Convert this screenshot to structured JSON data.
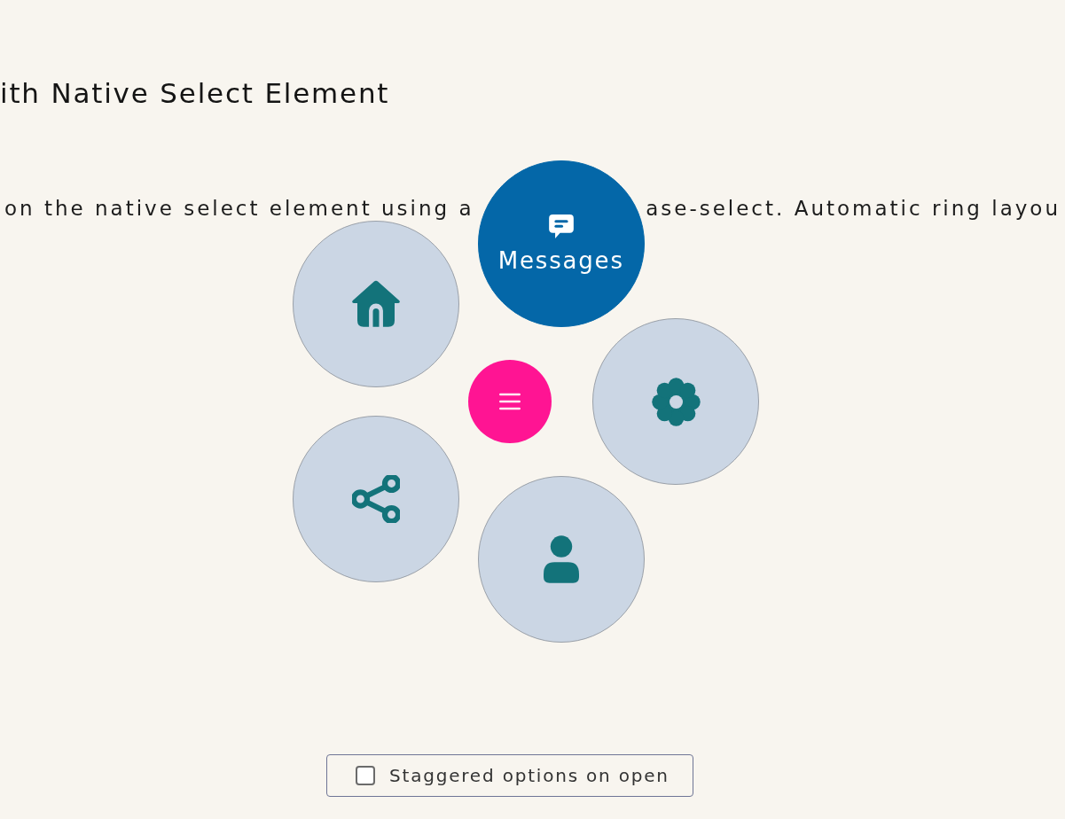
{
  "heading": "ith Native Select Element",
  "description": {
    "before": "on the native select element using a",
    "after": "ase-select. Automatic ring layou"
  },
  "menu": {
    "options": [
      {
        "kind": "home",
        "selected": false
      },
      {
        "kind": "chat",
        "selected": true,
        "label": "Messages"
      },
      {
        "kind": "gear",
        "selected": false
      },
      {
        "kind": "person",
        "selected": false
      },
      {
        "kind": "share",
        "selected": false
      }
    ]
  },
  "stagger_toggle": {
    "label": "Staggered options on open",
    "checked": false
  }
}
